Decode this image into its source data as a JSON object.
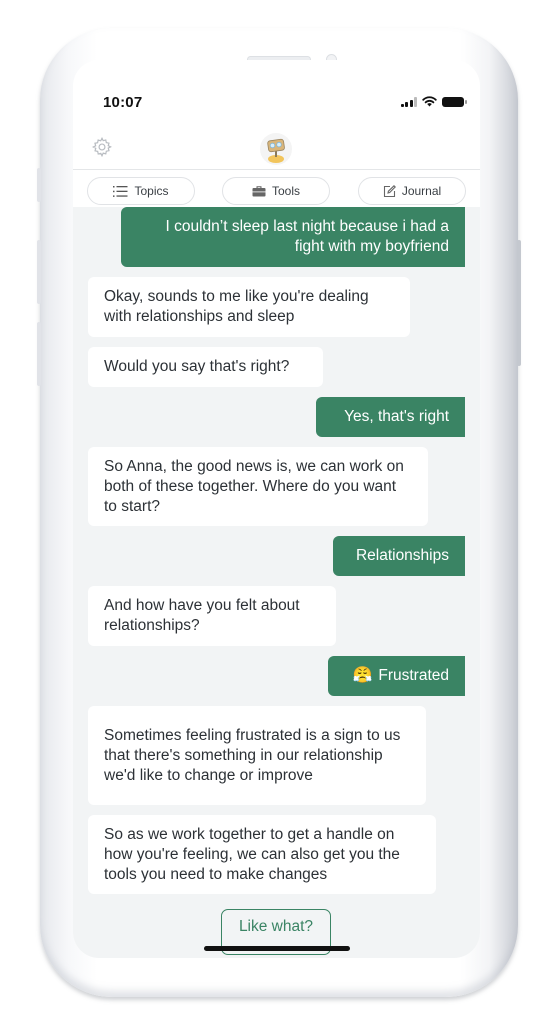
{
  "status_bar": {
    "time": "10:07",
    "icons": [
      "cellular-signal-icon",
      "wifi-icon",
      "battery-icon"
    ]
  },
  "header": {
    "settings_icon": "gear-icon",
    "avatar_icon": "robot-avatar-icon"
  },
  "tabs": [
    {
      "label": "Topics",
      "icon": "list-icon"
    },
    {
      "label": "Tools",
      "icon": "toolbox-icon"
    },
    {
      "label": "Journal",
      "icon": "edit-icon"
    }
  ],
  "messages": [
    {
      "sender": "user",
      "text": "I couldn’t sleep last night because i had a fight with my boyfriend"
    },
    {
      "sender": "bot",
      "text": "Okay, sounds to me like you're dealing with relationships and sleep"
    },
    {
      "sender": "bot",
      "text": "Would you say that's right?"
    },
    {
      "sender": "user",
      "text": "Yes, that's right"
    },
    {
      "sender": "bot",
      "text": "So Anna, the good news is, we can work on both of these together. Where do you want to start?"
    },
    {
      "sender": "user",
      "text": "Relationships"
    },
    {
      "sender": "bot",
      "text": "And how have you felt about relationships?"
    },
    {
      "sender": "user",
      "emoji": "😤",
      "text": "Frustrated"
    },
    {
      "sender": "bot",
      "text": "Sometimes feeling frustrated is a sign to us that there's something in our relationship we'd like to change or improve"
    },
    {
      "sender": "bot",
      "text": "So as we work together to get a handle on how you're feeling, we can also get you the tools you need to make changes"
    }
  ],
  "quick_reply": {
    "label": "Like what?"
  },
  "colors": {
    "accent": "#3a8464",
    "chat_background": "#f2f4f5",
    "bot_bubble": "#ffffff",
    "bot_text": "#2c3136"
  }
}
